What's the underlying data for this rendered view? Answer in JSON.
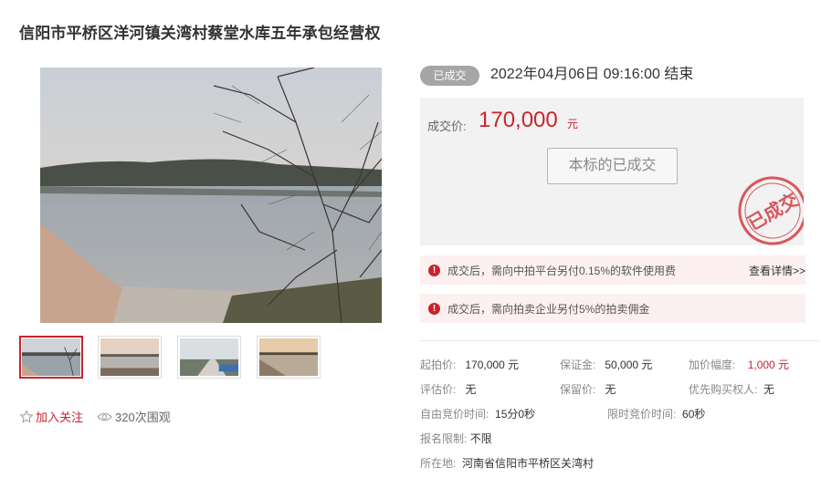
{
  "title": "信阳市平桥区洋河镇关湾村蔡堂水库五年承包经营权",
  "gallery": {
    "main_image": "reservoir-lake-photo",
    "thumbnails": [
      "reservoir-thumb-1",
      "reservoir-thumb-2",
      "reservoir-thumb-3",
      "reservoir-thumb-4"
    ]
  },
  "actions": {
    "follow_label": "加入关注",
    "follow_icon": "star-icon",
    "views_label": "320次围观",
    "views_icon": "eye-icon"
  },
  "status": {
    "badge": "已成交",
    "end_time": "2022年04月06日  09:16:00 结束"
  },
  "price": {
    "label": "成交价:",
    "value": "170,000",
    "unit": "元",
    "button_label": "本标的已成交",
    "stamp_text": "已成交"
  },
  "notices": [
    {
      "text": "成交后，需向中拍平台另付0.15%的软件使用费",
      "link": "查看详情>>"
    },
    {
      "text": "成交后，需向拍卖企业另付5%的拍卖佣金"
    }
  ],
  "details": {
    "start_price_label": "起拍价:",
    "start_price": "170,000 元",
    "deposit_label": "保证金:",
    "deposit": "50,000 元",
    "increment_label": "加价幅度:",
    "increment": "1,000 元",
    "appraisal_label": "评估价:",
    "appraisal": "无",
    "reserve_label": "保留价:",
    "reserve": "无",
    "priority_label": "优先购买权人:",
    "priority": "无",
    "free_bid_label": "自由竞价时间:",
    "free_bid": "15分0秒",
    "limited_bid_label": "限时竞价时间:",
    "limited_bid": "60秒",
    "signup_label": "报名限制:",
    "signup": "不限",
    "location_label": "所在地:",
    "location": "河南省信阳市平桥区关湾村"
  },
  "colors": {
    "accent": "#c9242e",
    "badge_grey": "#a6a6a6",
    "price_box_bg": "#f2f2f2",
    "notice_bg": "#fdf0f0"
  }
}
